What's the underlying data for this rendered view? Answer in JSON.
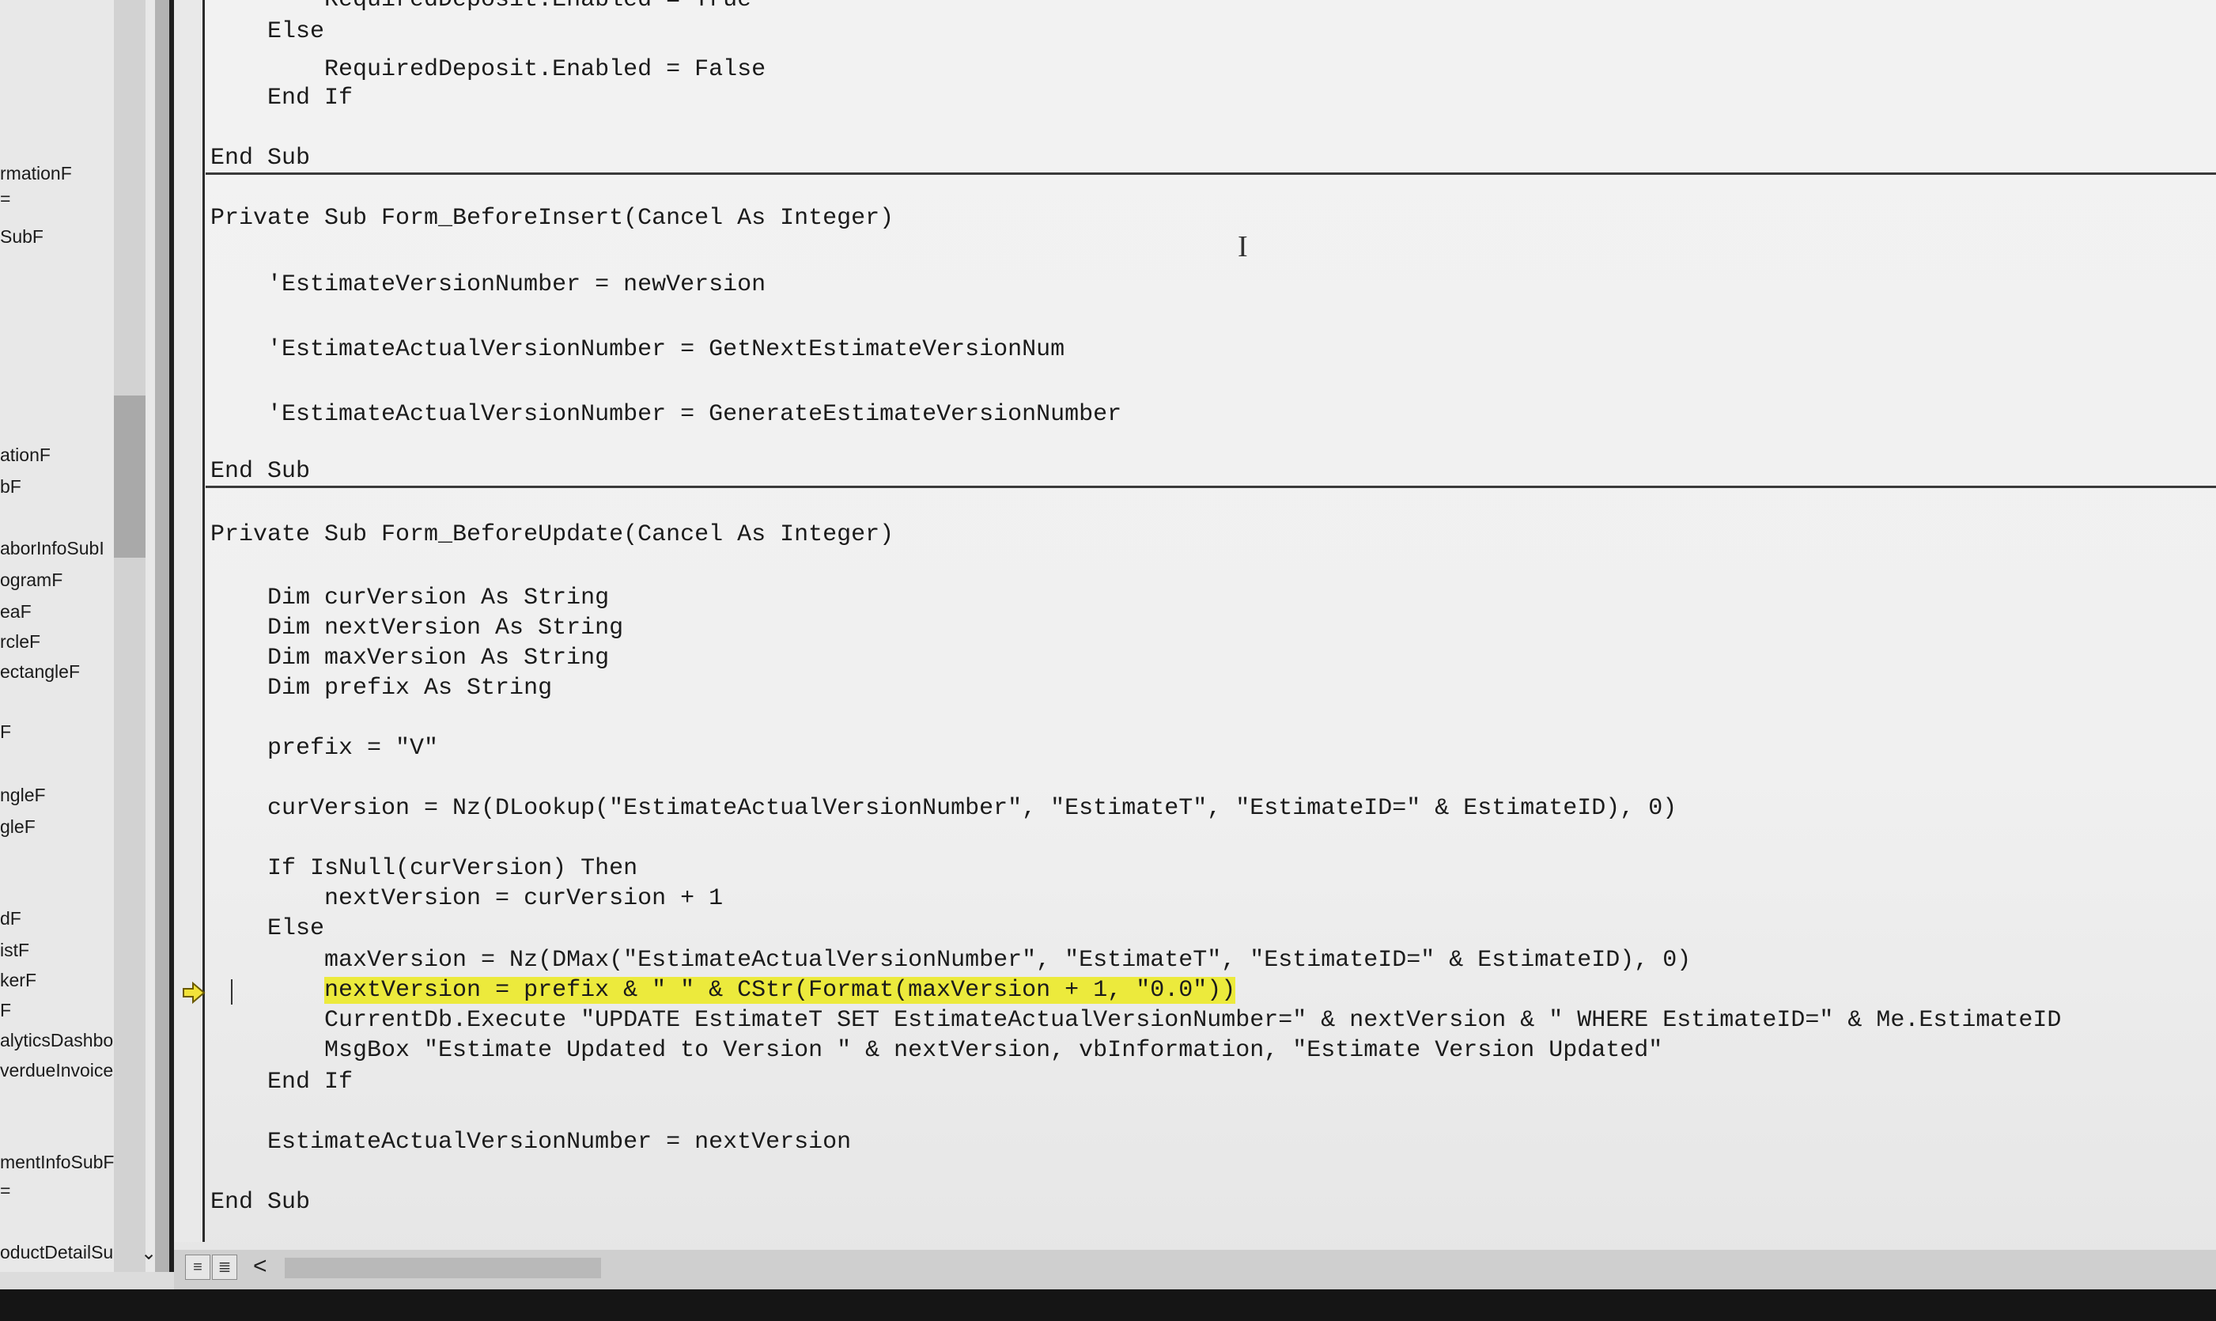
{
  "explorer": {
    "items": [
      "rmationF",
      "=",
      "SubF",
      "ationF",
      "bF",
      "aborInfoSubI",
      "ogramF",
      "eaF",
      "rcleF",
      "ectangleF",
      "F",
      "ngleF",
      "gleF",
      "dF",
      "istF",
      "kerF",
      "F",
      "alyticsDashbo",
      "verdueInvoices",
      "mentInfoSubF",
      "=",
      "oductDetailSub"
    ],
    "expander_icon": "chevron-down-icon",
    "next_icon": "chevron-right-icon"
  },
  "code": {
    "lines": [
      "        RequiredDeposit.Enabled = True",
      "    Else",
      "        RequiredDeposit.Enabled = False",
      "    End If",
      "",
      "End Sub",
      "Private Sub Form_BeforeInsert(Cancel As Integer)",
      "",
      "    'EstimateVersionNumber = newVersion",
      "",
      "    'EstimateActualVersionNumber = GetNextEstimateVersionNum",
      "",
      "    'EstimateActualVersionNumber = GenerateEstimateVersionNumber",
      "",
      "End Sub",
      "Private Sub Form_BeforeUpdate(Cancel As Integer)",
      "",
      "    Dim curVersion As String",
      "    Dim nextVersion As String",
      "    Dim maxVersion As String",
      "    Dim prefix As String",
      "",
      "    prefix = \"V\"",
      "",
      "    curVersion = Nz(DLookup(\"EstimateActualVersionNumber\", \"EstimateT\", \"EstimateID=\" & EstimateID), 0)",
      "",
      "    If IsNull(curVersion) Then",
      "        nextVersion = curVersion + 1",
      "    Else",
      "        maxVersion = Nz(DMax(\"EstimateActualVersionNumber\", \"EstimateT\", \"EstimateID=\" & EstimateID), 0)",
      "        nextVersion = prefix & \" \" & CStr(Format(maxVersion + 1, \"0.0\"))",
      "        CurrentDb.Execute \"UPDATE EstimateT SET EstimateActualVersionNumber=\" & nextVersion & \" WHERE EstimateID=\" & Me.EstimateID",
      "        MsgBox \"Estimate Updated to Version \" & nextVersion, vbInformation, \"Estimate Version Updated\"",
      "    End If",
      "",
      "    EstimateActualVersionNumber = nextVersion",
      "",
      "End Sub"
    ],
    "highlighted_line_index": 30,
    "highlight_color": "#ecea3c",
    "execution_arrow_icon": "execution-arrow-icon",
    "mouse_cursor_icon": "ibeam-cursor-icon"
  },
  "bottom_bar": {
    "procedure_view_icon": "procedure-view-icon",
    "full_module_view_icon": "full-module-view-icon",
    "scroll_left_icon": "chevron-left-icon",
    "scroll_left_glyph": "<"
  }
}
